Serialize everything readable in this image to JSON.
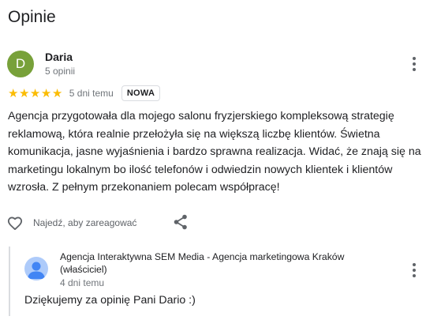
{
  "section": {
    "title": "Opinie"
  },
  "review": {
    "author": {
      "initial": "D",
      "name": "Daria",
      "meta": "5 opinii",
      "avatar_color": "#78a13a"
    },
    "rating": 5,
    "time": "5 dni temu",
    "badge": "NOWA",
    "text": "Agencja przygotowała dla mojego salonu fryzjerskiego kompleksową strategię reklamową, która realnie przełożyła się na większą liczbę klientów. Świetna komunikacja, jasne wyjaśnienia i bardzo sprawna realizacja. Widać, że znają się na marketingu lokalnym bo ilość telefonów i odwiedzin nowych klientek i klientów wzrosła. Z pełnym przekonaniem polecam współpracę!",
    "like_label": "Najedź, aby zareagować",
    "icons": {
      "like": "heart-outline-icon",
      "share": "share-icon",
      "more": "more-vert-icon"
    }
  },
  "reply": {
    "owner_name": "Agencja Interaktywna SEM Media - Agencja marketingowa Kraków (właściciel)",
    "time": "4 dni temu",
    "text": "Dziękujemy za opinię Pani Dario :)",
    "icons": {
      "avatar": "default-profile-avatar-icon",
      "more": "more-vert-icon"
    }
  },
  "colors": {
    "star": "#fbbc04",
    "secondary_text": "#70757a",
    "divider": "#dadce0"
  }
}
